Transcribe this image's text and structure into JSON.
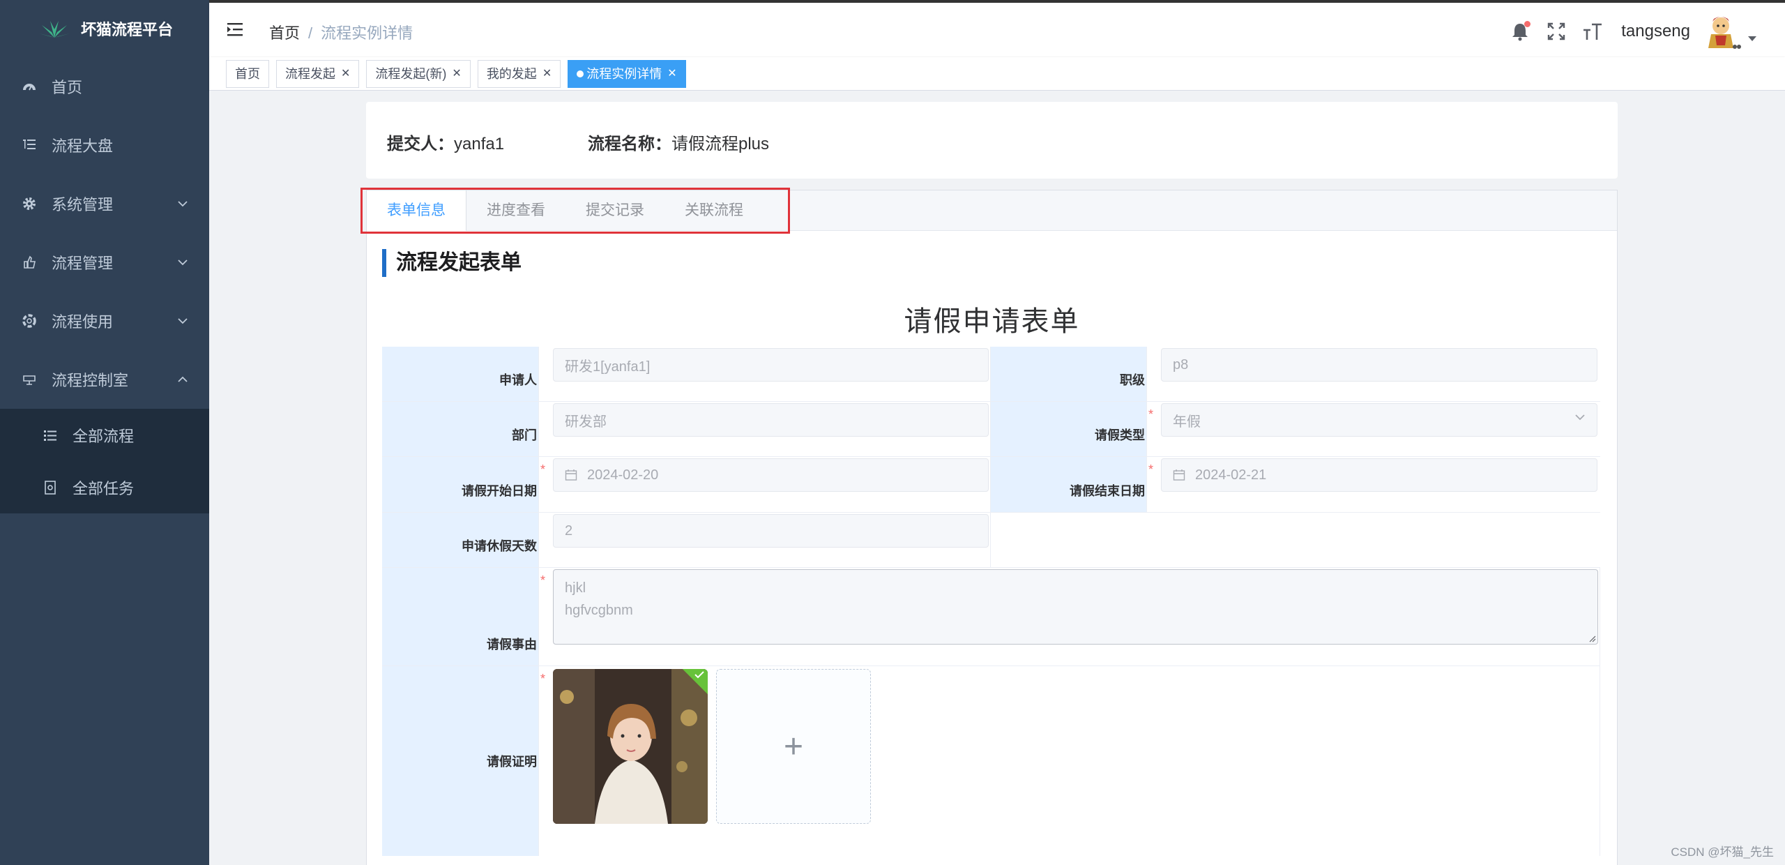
{
  "app": {
    "title": "坏猫流程平台"
  },
  "sidebar": {
    "items": [
      {
        "label": "首页",
        "icon": "dashboard-icon"
      },
      {
        "label": "流程大盘",
        "icon": "list-tree-icon"
      },
      {
        "label": "系统管理",
        "icon": "gear-icon",
        "expandable": true
      },
      {
        "label": "流程管理",
        "icon": "hand-icon",
        "expandable": true
      },
      {
        "label": "流程使用",
        "icon": "lifebuoy-icon",
        "expandable": true
      },
      {
        "label": "流程控制室",
        "icon": "monitor-icon",
        "expandable": true,
        "expanded": true
      }
    ],
    "subitems": [
      {
        "label": "全部流程",
        "icon": "list-icon"
      },
      {
        "label": "全部任务",
        "icon": "task-icon"
      }
    ]
  },
  "breadcrumb": {
    "home": "首页",
    "separator": "/",
    "current": "流程实例详情"
  },
  "user": {
    "name": "tangseng"
  },
  "tags": [
    {
      "label": "首页",
      "closable": false
    },
    {
      "label": "流程发起",
      "closable": true
    },
    {
      "label": "流程发起(新)",
      "closable": true
    },
    {
      "label": "我的发起",
      "closable": true
    },
    {
      "label": "流程实例详情",
      "closable": true,
      "active": true
    }
  ],
  "summary": {
    "submitter_label": "提交人：",
    "submitter": "yanfa1",
    "process_label": "流程名称：",
    "process": "请假流程plus"
  },
  "tabs": [
    "表单信息",
    "进度查看",
    "提交记录",
    "关联流程"
  ],
  "section_title": "流程发起表单",
  "form": {
    "title": "请假申请表单",
    "applicant_label": "申请人",
    "applicant": "研发1[yanfa1]",
    "level_label": "职级",
    "level": "p8",
    "dept_label": "部门",
    "dept": "研发部",
    "leave_type_label": "请假类型",
    "leave_type": "年假",
    "start_label": "请假开始日期",
    "start": "2024-02-20",
    "end_label": "请假结束日期",
    "end": "2024-02-21",
    "days_label": "申请休假天数",
    "days": "2",
    "reason_label": "请假事由",
    "reason_line1": "hjkl",
    "reason_line2": "hgfvcgbnm",
    "proof_label": "请假证明",
    "required_mark": "*",
    "add_symbol": "+"
  },
  "watermark": "CSDN @坏猫_先生",
  "colors": {
    "sidebar": "#304156",
    "submenu": "#1f2d3d",
    "accent": "#409eff",
    "active_tag": "#3a9ff5",
    "label_bg": "#e5f1ff",
    "highlight": "#e0333a"
  }
}
